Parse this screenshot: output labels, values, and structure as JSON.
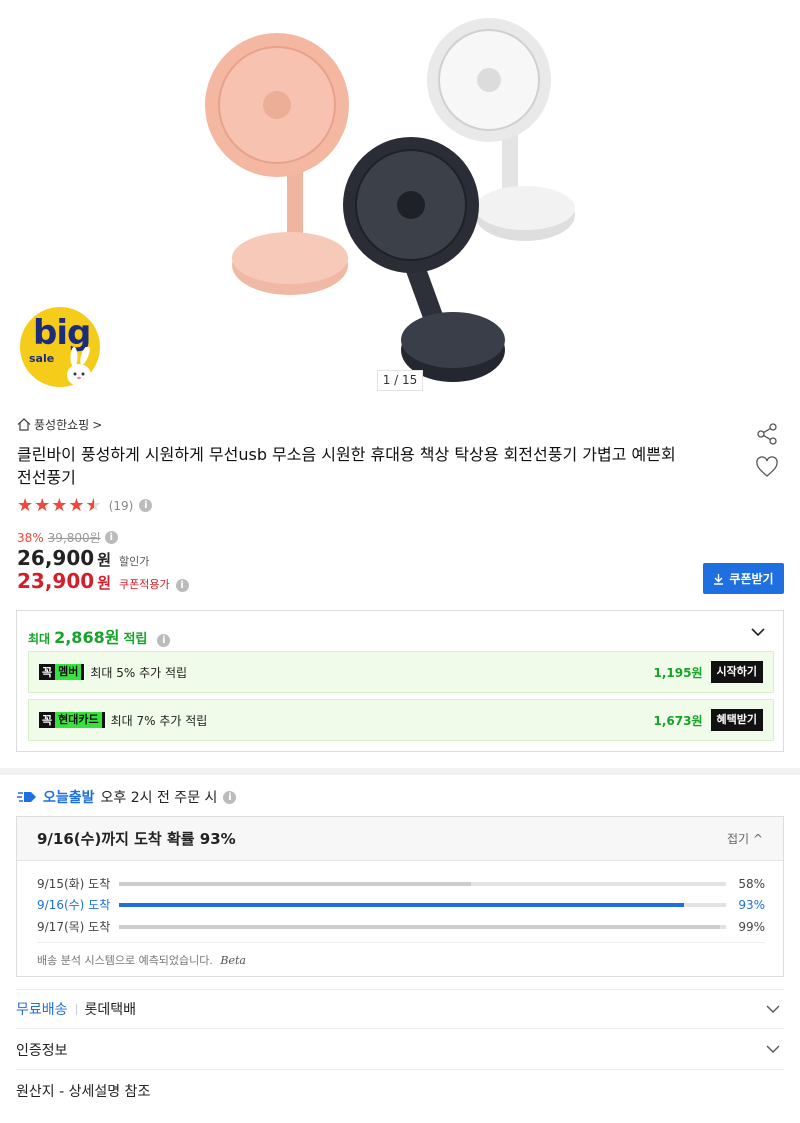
{
  "gallery": {
    "badge_big": "big",
    "badge_sale": "sale",
    "pager": "1 / 15"
  },
  "seller": {
    "name": "풍성한쇼핑",
    "chevron": ">"
  },
  "product": {
    "title": "클린바이 풍성하게 시원하게 무선usb 무소음 시원한 휴대용 책상 탁상용 회전선풍기 가볍고 예쁜회전선풍기",
    "stars": "★★★★★",
    "review_count": "(19)",
    "rating_fraction": 0.9
  },
  "price": {
    "discount_rate": "38%",
    "original": "39,800원",
    "sale_num": "26,900",
    "sale_won": "원",
    "sale_label": "할인가",
    "coupon_num": "23,900",
    "coupon_won": "원",
    "coupon_label": "쿠폰적용가",
    "coupon_button": "쿠폰받기"
  },
  "points": {
    "prefix": "최대",
    "amount": "2,868원",
    "suffix": "적립",
    "offers": [
      {
        "tag_k": "꼭",
        "tag_name": "멤버",
        "text": "최대 5% 추가 적립",
        "amount": "1,195원",
        "button": "시작하기"
      },
      {
        "tag_k": "꼭",
        "tag_name": "현대카드",
        "text": "최대 7% 추가 적립",
        "amount": "1,673원",
        "button": "혜택받기"
      }
    ]
  },
  "delivery": {
    "brand": "오늘출발",
    "condition": "오후 2시 전 주문 시",
    "prob_title": "9/16(수)까지 도착 확률 93%",
    "collapse": "접기",
    "rows": [
      {
        "label": "9/15(화) 도착",
        "pct": "58%",
        "value": 58
      },
      {
        "label": "9/16(수) 도착",
        "pct": "93%",
        "value": 93
      },
      {
        "label": "9/17(목) 도착",
        "pct": "99%",
        "value": 99
      }
    ],
    "note": "배송 분석 시스템으로 예측되었습니다.",
    "beta": "Beta"
  },
  "shipping": {
    "free": "무료배송",
    "carrier": "롯데택배"
  },
  "certification": "인증정보",
  "origin": "원산지 - 상세설명 참조",
  "colors": {
    "accent_blue": "#1e6fdf",
    "point_green": "#17a329",
    "price_red": "#d31e2c",
    "star_red": "#f2483a"
  }
}
